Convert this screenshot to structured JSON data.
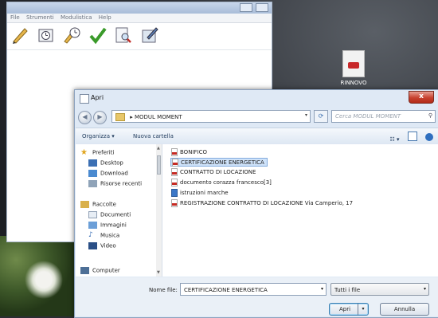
{
  "app": {
    "title": "",
    "menu": [
      "File",
      "Strumenti",
      "Modulistica",
      "Help"
    ]
  },
  "desktop": {
    "icon_label": "RINNOVO"
  },
  "dialog": {
    "title": "Apri",
    "close_label": "x",
    "address": {
      "segments": [
        "MODUL MOMENT"
      ],
      "separator": "▸"
    },
    "search_placeholder": "Cerca MODUL MOMENT",
    "commands": {
      "organize": "Organizza ▾",
      "new_folder": "Nuova cartella"
    },
    "nav": {
      "favorites": "Preferiti",
      "desktop": "Desktop",
      "download": "Download",
      "recent": "Risorse recenti",
      "libraries": "Raccolte",
      "documents": "Documenti",
      "images": "Immagini",
      "music": "Musica",
      "video": "Video",
      "computer": "Computer"
    },
    "files": [
      {
        "name": "BONIFICO",
        "type": "pdf",
        "selected": false
      },
      {
        "name": "CERTIFICAZIONE ENERGETICA",
        "type": "pdf",
        "selected": true
      },
      {
        "name": "CONTRATTO DI LOCAZIONE",
        "type": "pdf",
        "selected": false
      },
      {
        "name": "documento corazza francesco[3]",
        "type": "pdf",
        "selected": false
      },
      {
        "name": "istruzioni marche",
        "type": "web",
        "selected": false
      },
      {
        "name": "REGISTRAZIONE CONTRATTO DI LOCAZIONE Via Camperio, 17",
        "type": "pdf",
        "selected": false
      }
    ],
    "footer": {
      "filename_label": "Nome file:",
      "filename_value": "CERTIFICAZIONE ENERGETICA",
      "filetype_value": "Tutti i file",
      "open_label": "Apri",
      "cancel_label": "Annulla"
    }
  }
}
